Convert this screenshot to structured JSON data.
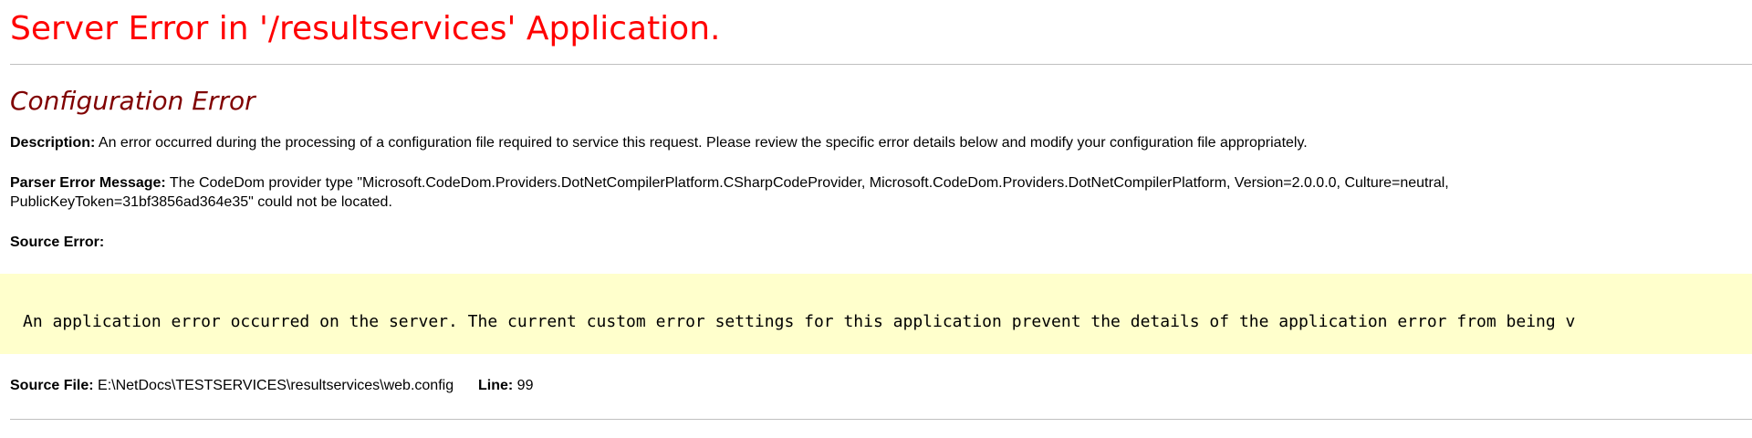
{
  "header": {
    "title": "Server Error in '/resultservices' Application."
  },
  "error": {
    "subtitle": "Configuration Error",
    "description_label": "Description:",
    "description_text": "An error occurred during the processing of a configuration file required to service this request. Please review the specific error details below and modify your configuration file appropriately.",
    "parser_label": "Parser Error Message:",
    "parser_text_line1": "The CodeDom provider type \"Microsoft.CodeDom.Providers.DotNetCompilerPlatform.CSharpCodeProvider, Microsoft.CodeDom.Providers.DotNetCompilerPlatform, Version=2.0.0.0, Culture=neutral,",
    "parser_text_line2": "PublicKeyToken=31bf3856ad364e35\" could not be located.",
    "source_error_label": "Source Error:",
    "source_error_text": "An application error occurred on the server. The current custom error settings for this application prevent the details of the application error from being v",
    "source_file_label": "Source File:",
    "source_file_value": "E:\\NetDocs\\TESTSERVICES\\resultservices\\web.config",
    "line_label": "Line:",
    "line_value": "99"
  },
  "colors": {
    "title": "#ff0000",
    "subtitle": "#800000",
    "code_background": "#ffffcc",
    "divider": "#c0c0c0"
  }
}
